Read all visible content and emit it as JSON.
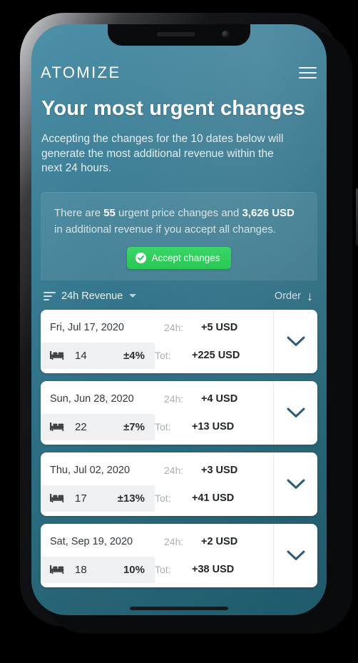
{
  "app": {
    "logo_text": "ATOMIZE",
    "menu_icon": "hamburger-menu-icon"
  },
  "header": {
    "headline": "Your most urgent changes",
    "subline": "Accepting the changes for the 10 dates below will generate the most additional revenue within the next 24 hours."
  },
  "info_card": {
    "text_part1": "There are ",
    "count": "55",
    "text_part2": " urgent price changes and ",
    "amount": "3,626 USD",
    "text_part3": " in additional revenue if you accept all changes.",
    "accept_button": "Accept changes",
    "accept_icon": "check-circle-icon",
    "accent_color": "#30d158"
  },
  "sortbar": {
    "sort_icon": "sort-filter-icon",
    "sort_label": "24h Revenue",
    "caret_icon": "caret-down-icon",
    "order_label": "Order",
    "order_icon": "arrow-down-icon"
  },
  "list": {
    "label_24h": "24h:",
    "label_tot": "Tot:",
    "bed_icon": "bed-icon",
    "expand_icon": "chevron-down-icon",
    "rows": [
      {
        "date": "Fri, Jul 17, 2020",
        "occupancy": "14",
        "percent": "±4%",
        "revenue_24h": "+5 USD",
        "revenue_total": "+225 USD"
      },
      {
        "date": "Sun, Jun 28, 2020",
        "occupancy": "22",
        "percent": "±7%",
        "revenue_24h": "+4 USD",
        "revenue_total": "+13 USD"
      },
      {
        "date": "Thu, Jul 02, 2020",
        "occupancy": "17",
        "percent": "±13%",
        "revenue_24h": "+3 USD",
        "revenue_total": "+41 USD"
      },
      {
        "date": "Sat, Sep 19, 2020",
        "occupancy": "18",
        "percent": "10%",
        "revenue_24h": "+2 USD",
        "revenue_total": "+38 USD"
      }
    ]
  },
  "theme": {
    "gradient_top": "#4d90a8",
    "gradient_bottom": "#1f5a6b",
    "chevron_color": "#2e5c74",
    "card_background": "#ffffff"
  }
}
